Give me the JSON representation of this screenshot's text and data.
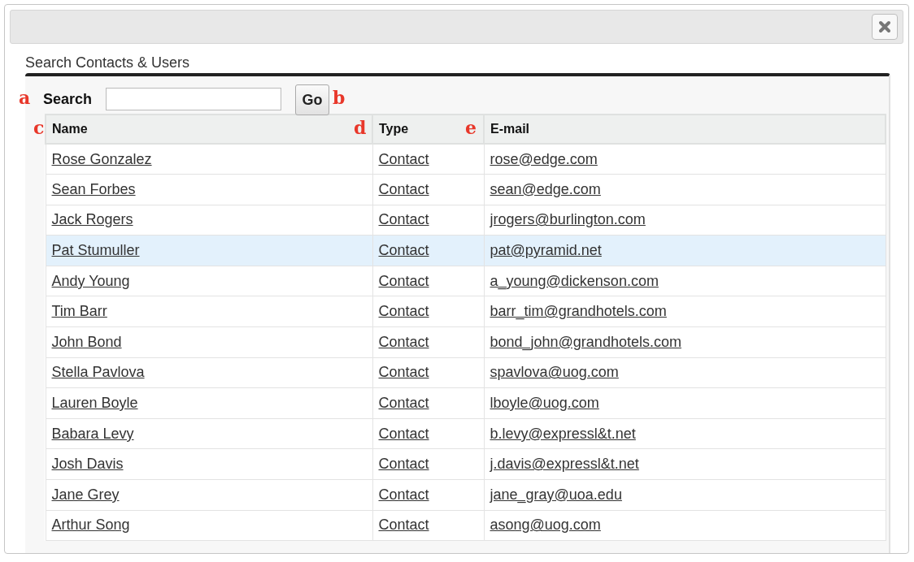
{
  "dialog": {
    "title": "Search Contacts & Users"
  },
  "search": {
    "label": "Search",
    "callout": "a",
    "go_button": {
      "label": "Go",
      "callout": "b"
    }
  },
  "table": {
    "columns": [
      {
        "label": "Name",
        "callout": "c"
      },
      {
        "label": "Type",
        "callout": "d"
      },
      {
        "label": "E-mail",
        "callout": "e"
      }
    ],
    "rows": [
      {
        "name": "Rose Gonzalez",
        "type": "Contact",
        "email": "rose@edge.com",
        "selected": false
      },
      {
        "name": "Sean Forbes",
        "type": "Contact",
        "email": "sean@edge.com",
        "selected": false
      },
      {
        "name": "Jack Rogers",
        "type": "Contact",
        "email": "jrogers@burlington.com",
        "selected": false
      },
      {
        "name": "Pat Stumuller",
        "type": "Contact",
        "email": "pat@pyramid.net",
        "selected": true
      },
      {
        "name": "Andy Young",
        "type": "Contact",
        "email": "a_young@dickenson.com",
        "selected": false
      },
      {
        "name": "Tim Barr",
        "type": "Contact",
        "email": "barr_tim@grandhotels.com",
        "selected": false
      },
      {
        "name": "John Bond",
        "type": "Contact",
        "email": "bond_john@grandhotels.com",
        "selected": false
      },
      {
        "name": "Stella Pavlova",
        "type": "Contact",
        "email": "spavlova@uog.com",
        "selected": false
      },
      {
        "name": "Lauren Boyle",
        "type": "Contact",
        "email": "lboyle@uog.com",
        "selected": false
      },
      {
        "name": "Babara Levy",
        "type": "Contact",
        "email": "b.levy@expressl&t.net",
        "selected": false
      },
      {
        "name": "Josh Davis",
        "type": "Contact",
        "email": "j.davis@expressl&t.net",
        "selected": false
      },
      {
        "name": "Jane Grey",
        "type": "Contact",
        "email": "jane_gray@uoa.edu",
        "selected": false
      },
      {
        "name": "Arthur Song",
        "type": "Contact",
        "email": "asong@uog.com",
        "selected": false
      }
    ]
  }
}
